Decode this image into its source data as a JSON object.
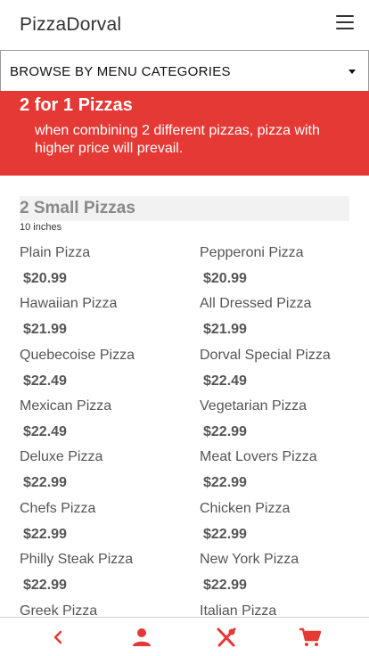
{
  "header": {
    "brand": "PizzaDorval",
    "menu_icon": "hamburger-icon"
  },
  "category_select": {
    "selected": "BROWSE BY MENU CATEGORIES",
    "icon": "caret-down-icon"
  },
  "promo": {
    "title": "2 for 1 Pizzas",
    "description": "when combining 2 different pizzas, pizza with higher price will prevail.",
    "background": "#e53935"
  },
  "section": {
    "title": "2 Small Pizzas",
    "subtitle": "10 inches",
    "items": [
      {
        "name": "Plain Pizza",
        "price": "$20.99"
      },
      {
        "name": "Pepperoni Pizza",
        "price": "$20.99"
      },
      {
        "name": "Hawaiian Pizza",
        "price": "$21.99"
      },
      {
        "name": "All Dressed Pizza",
        "price": "$21.99"
      },
      {
        "name": "Quebecoise Pizza",
        "price": "$22.49"
      },
      {
        "name": "Dorval Special Pizza",
        "price": "$22.49"
      },
      {
        "name": "Mexican Pizza",
        "price": "$22.49"
      },
      {
        "name": "Vegetarian Pizza",
        "price": "$22.99"
      },
      {
        "name": "Deluxe Pizza",
        "price": "$22.99"
      },
      {
        "name": "Meat Lovers Pizza",
        "price": "$22.99"
      },
      {
        "name": "Chefs Pizza",
        "price": "$22.99"
      },
      {
        "name": "Chicken Pizza",
        "price": "$22.99"
      },
      {
        "name": "Philly Steak Pizza",
        "price": "$22.99"
      },
      {
        "name": "New York Pizza",
        "price": "$22.99"
      },
      {
        "name": "Greek Pizza",
        "price": ""
      },
      {
        "name": "Italian Pizza",
        "price": ""
      }
    ]
  },
  "bottom_nav": {
    "accent": "#e53935",
    "buttons": [
      {
        "icon": "chevron-left-icon"
      },
      {
        "icon": "user-icon"
      },
      {
        "icon": "utensils-icon"
      },
      {
        "icon": "cart-icon"
      }
    ]
  }
}
